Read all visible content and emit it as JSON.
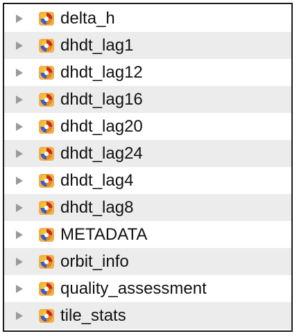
{
  "tree": {
    "items": [
      {
        "label": "delta_h",
        "icon": "hdf-group-icon"
      },
      {
        "label": "dhdt_lag1",
        "icon": "hdf-group-icon"
      },
      {
        "label": "dhdt_lag12",
        "icon": "hdf-group-icon"
      },
      {
        "label": "dhdt_lag16",
        "icon": "hdf-group-icon"
      },
      {
        "label": "dhdt_lag20",
        "icon": "hdf-group-icon"
      },
      {
        "label": "dhdt_lag24",
        "icon": "hdf-group-icon"
      },
      {
        "label": "dhdt_lag4",
        "icon": "hdf-group-icon"
      },
      {
        "label": "dhdt_lag8",
        "icon": "hdf-group-icon"
      },
      {
        "label": "METADATA",
        "icon": "hdf-group-icon"
      },
      {
        "label": "orbit_info",
        "icon": "hdf-group-icon"
      },
      {
        "label": "quality_assessment",
        "icon": "hdf-group-icon"
      },
      {
        "label": "tile_stats",
        "icon": "hdf-group-icon"
      }
    ]
  },
  "colors": {
    "row_alt": "#ececec",
    "border": "#1a1a1a",
    "disclosure": "#9a9a9a",
    "icon_orange": "#e8891c",
    "icon_red": "#cc2a1e",
    "icon_blue": "#3a5fc8"
  }
}
